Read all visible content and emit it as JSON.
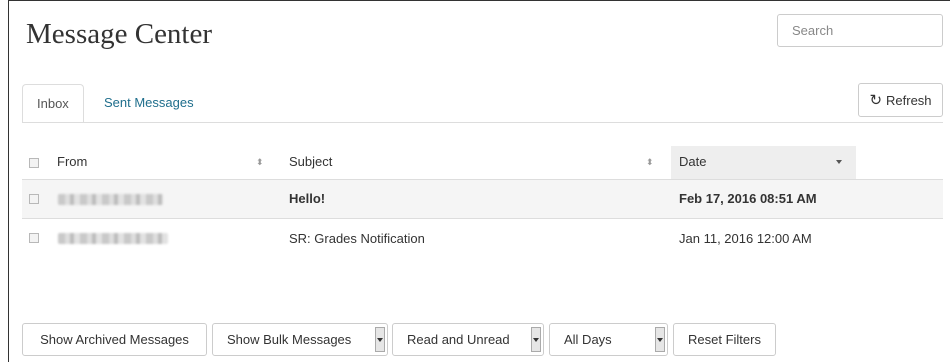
{
  "header": {
    "title": "Message Center"
  },
  "search": {
    "placeholder": "Search",
    "value": ""
  },
  "tabs": [
    {
      "label": "Inbox",
      "active": true
    },
    {
      "label": "Sent Messages",
      "active": false
    }
  ],
  "toolbar": {
    "refresh_label": "Refresh",
    "refresh_icon": "refresh-icon"
  },
  "table": {
    "columns": [
      {
        "label": "From",
        "sort_icon": "sort-both-icon"
      },
      {
        "label": "Subject",
        "sort_icon": "sort-both-icon"
      },
      {
        "label": "Date",
        "sort_icon": "sort-desc-icon",
        "sorted": true
      }
    ],
    "rows": [
      {
        "from": "",
        "subject": "Hello!",
        "date": "Feb 17, 2016 08:51 AM",
        "unread": true
      },
      {
        "from": "",
        "subject": "SR: Grades Notification",
        "date": "Jan 11, 2016 12:00 AM",
        "unread": false
      }
    ]
  },
  "filters": {
    "archived_label": "Show Archived Messages",
    "bulk": "Show Bulk Messages",
    "read_state": "Read and Unread",
    "days": "All Days",
    "reset_label": "Reset Filters"
  },
  "colors": {
    "link": "#1f6e8c",
    "border": "#cccccc",
    "sorted_header_bg": "#eeeeee",
    "unread_row_bg": "#f5f5f5"
  }
}
